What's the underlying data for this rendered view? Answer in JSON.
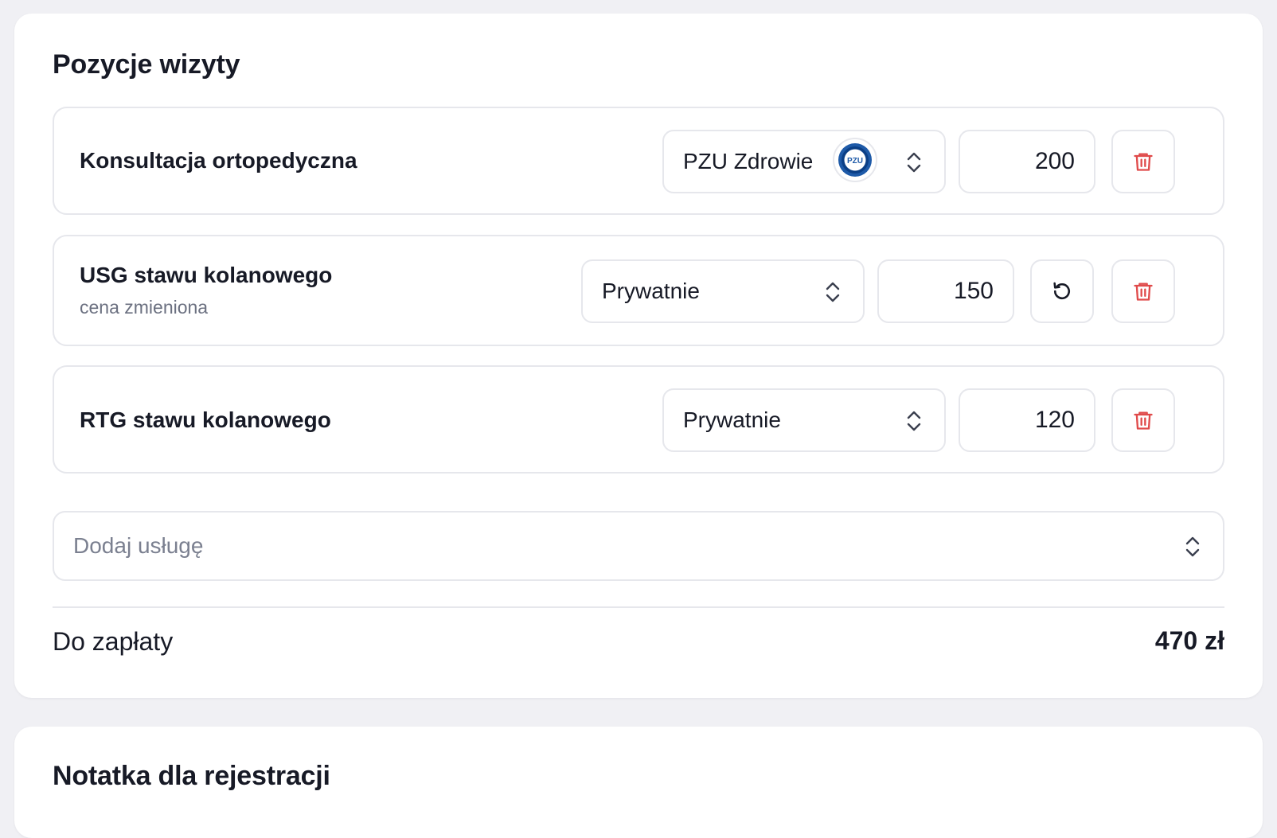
{
  "visit_card": {
    "title": "Pozycje wizyty",
    "items": [
      {
        "name": "Konsultacja ortopedyczna",
        "payer": "PZU Zdrowie",
        "payer_logo_text": "PZU",
        "price": "200"
      },
      {
        "name": "USG stawu kolanowego",
        "note": "cena zmieniona",
        "payer": "Prywatnie",
        "price": "150"
      },
      {
        "name": "RTG stawu kolanowego",
        "payer": "Prywatnie",
        "price": "120"
      }
    ],
    "add_service_placeholder": "Dodaj usługę",
    "total_label": "Do zapłaty",
    "total_value": "470 zł"
  },
  "note_card": {
    "title": "Notatka dla rejestracji"
  },
  "icons": {
    "select_chevron": "chevron-up-down-icon",
    "delete": "trash-icon",
    "reset_price": "reset-icon",
    "payer_logo": "pzu-logo-icon"
  },
  "colors": {
    "page_background": "#f0f0f4",
    "card_background": "#ffffff",
    "border": "#e6e7ec",
    "text_primary": "#171a26",
    "text_muted": "#6b7080",
    "delete_red": "#e04b4b",
    "pzu_blue": "#1e5aa8"
  }
}
